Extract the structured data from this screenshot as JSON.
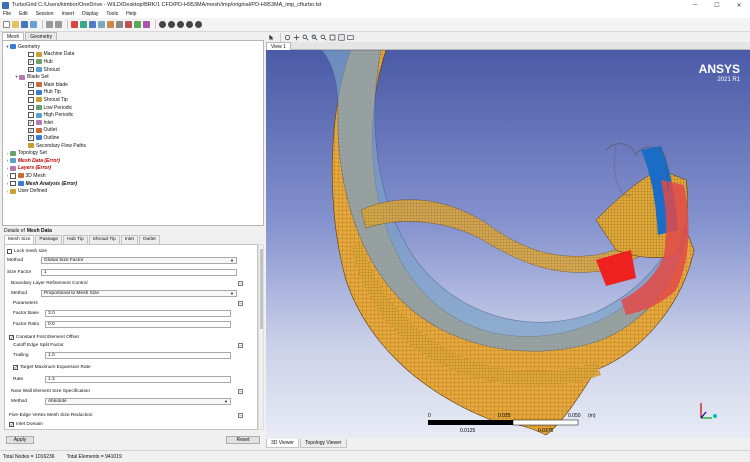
{
  "window": {
    "title": "TurboGrid  C:/Users/kimbor/OneDrive - WILD/Desktop/BRK/1 CFD/PD-H953MA/mesh/imp/original/PD-H953MA_imp_cfturbo.tst",
    "controls": [
      "─",
      "☐",
      "✕"
    ]
  },
  "menu": [
    "File",
    "Edit",
    "Session",
    "Insert",
    "Display",
    "Tools",
    "Help"
  ],
  "left_tabs": [
    "Mesh",
    "Geometry"
  ],
  "tree": [
    {
      "label": "Geometry",
      "indent": 0,
      "toggle": "▾",
      "check": null,
      "style": "normal"
    },
    {
      "label": "Machine Data",
      "indent": 2,
      "toggle": "",
      "check": "",
      "style": "normal"
    },
    {
      "label": "Hub",
      "indent": 2,
      "toggle": "",
      "check": "✓",
      "style": "normal"
    },
    {
      "label": "Shroud",
      "indent": 2,
      "toggle": "",
      "check": "✓",
      "style": "normal"
    },
    {
      "label": "Blade Set",
      "indent": 1,
      "toggle": "▾",
      "check": null,
      "style": "normal"
    },
    {
      "label": "Main blade",
      "indent": 2,
      "toggle": "›",
      "check": "✓",
      "style": "normal"
    },
    {
      "label": "Hub Tip",
      "indent": 2,
      "toggle": "",
      "check": "",
      "style": "normal"
    },
    {
      "label": "Shroud Tip",
      "indent": 2,
      "toggle": "",
      "check": "",
      "style": "normal"
    },
    {
      "label": "Low Periodic",
      "indent": 2,
      "toggle": "",
      "check": "",
      "style": "normal"
    },
    {
      "label": "High Periodic",
      "indent": 2,
      "toggle": "",
      "check": "",
      "style": "normal"
    },
    {
      "label": "Inlet",
      "indent": 2,
      "toggle": "",
      "check": "✓",
      "style": "normal"
    },
    {
      "label": "Outlet",
      "indent": 2,
      "toggle": "",
      "check": "✓",
      "style": "normal"
    },
    {
      "label": "Outline",
      "indent": 2,
      "toggle": "",
      "check": "✓",
      "style": "normal"
    },
    {
      "label": "Secondary Flow Paths",
      "indent": 2,
      "toggle": "",
      "check": null,
      "style": "normal"
    },
    {
      "label": "Topology Set",
      "indent": 0,
      "toggle": "›",
      "check": null,
      "style": "normal"
    },
    {
      "label": "Mesh Data (Error)",
      "indent": 0,
      "toggle": "›",
      "check": null,
      "style": "error"
    },
    {
      "label": "Layers (Error)",
      "indent": 0,
      "toggle": "›",
      "check": null,
      "style": "error"
    },
    {
      "label": "3D Mesh",
      "indent": 0,
      "toggle": "›",
      "check": "",
      "style": "normal"
    },
    {
      "label": "Mesh Analysis (Error)",
      "indent": 0,
      "toggle": "›",
      "check": "",
      "style": "bold"
    },
    {
      "label": "User Defined",
      "indent": 0,
      "toggle": "›",
      "check": null,
      "style": "normal"
    }
  ],
  "details": {
    "title_prefix": "Details of",
    "title_object": "Mesh Data",
    "tabs": [
      "Mesh Size",
      "Passage",
      "Hub Tip",
      "Shroud Tip",
      "Inlet",
      "Outlet"
    ],
    "lock_mesh_size": "Lock mesh size",
    "method_label": "Method",
    "method_value": "Global Size Factor",
    "size_factor_label": "Size Factor",
    "size_factor_value": "1",
    "blr_label": "Boundary Layer Refinement Control",
    "blr_method_label": "Method",
    "blr_method_value": "Proportional to Mesh Size",
    "parameters_label": "Parameters",
    "factor_base_label": "Factor Base",
    "factor_base_value": "3.0",
    "factor_ratio_label": "Factor Ratio",
    "factor_ratio_value": "0.0",
    "constant_first_label": "Constant First Element Offset",
    "cutoff_label": "Cutoff Edge Split Factor",
    "trailing_label": "Trailing",
    "trailing_value": "1.0",
    "target_max_label": "Target Maximum Expansion Rate",
    "rate_label": "Rate",
    "rate_value": "1.3",
    "near_wall_label": "Near Wall Element Size Specification",
    "nw_method_label": "Method",
    "nw_method_value": "Absolute",
    "five_edge_label": "Five-Edge Vertex Mesh Size Reduction",
    "inlet_domain_label": "Inlet Domain",
    "apply": "Apply",
    "reset": "Reset"
  },
  "status": {
    "total_nodes": "Total Nodes = 1016236",
    "total_elements": "Total Elements = 941019"
  },
  "viewer": {
    "view_tab": "View 1",
    "bottom_tabs": [
      "3D Viewer",
      "Topology Viewer"
    ],
    "logo": "ANSYS",
    "version": "2021 R1",
    "scale_ticks_top": [
      "0",
      "0.025",
      "0.050"
    ],
    "scale_unit": "(m)",
    "scale_ticks_bottom": [
      "0.0125",
      "0.0375"
    ],
    "colors": {
      "mesh": "#e8a83a",
      "shroud": "#7ba0c8",
      "inlet": "#1a6dc7",
      "outlet": "#e24a4a"
    }
  }
}
